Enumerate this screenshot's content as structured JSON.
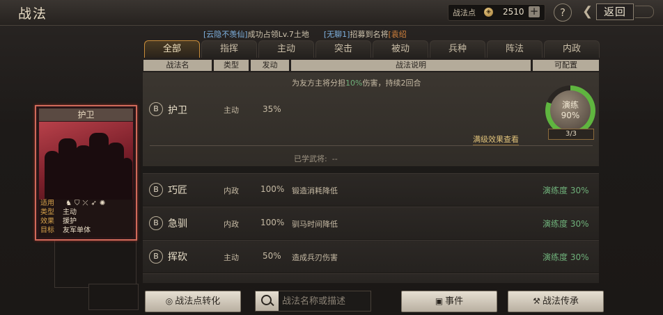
{
  "header": {
    "title": "战法",
    "points_label": "战法点",
    "points_value": "2510",
    "plus": "+",
    "help": "?",
    "back_label": "返回"
  },
  "marquee": {
    "player1": "[云隐不羡仙]",
    "text1": "成功占领Lv.7土地",
    "player2": "[无聊1]",
    "text2": "招募到名将",
    "tail": "[袁绍"
  },
  "tabs": [
    "全部",
    "指挥",
    "主动",
    "突击",
    "被动",
    "兵种",
    "阵法",
    "内政"
  ],
  "columns": {
    "name": "战法名",
    "type": "类型",
    "rate": "发动",
    "desc": "战法说明",
    "config": "可配置"
  },
  "expanded": {
    "grade": "B",
    "name": "护卫",
    "type": "主动",
    "rate": "35%",
    "desc_prefix": "为友方主将分担",
    "desc_pct": "10%",
    "desc_suffix": "伤害，持续2回合",
    "ring_label": "演练",
    "ring_pct": "90%",
    "ring_count": "3/3",
    "max_effect_link": "满级效果查看",
    "learned_label": "已学武将:",
    "learned_value": "--"
  },
  "rows": [
    {
      "grade": "B",
      "name": "巧匠",
      "type": "内政",
      "rate": "100%",
      "desc": "锻造消耗降低",
      "mastery": "演练度 30%"
    },
    {
      "grade": "B",
      "name": "急驯",
      "type": "内政",
      "rate": "100%",
      "desc": "驯马时间降低",
      "mastery": "演练度 30%"
    },
    {
      "grade": "B",
      "name": "挥砍",
      "type": "主动",
      "rate": "50%",
      "desc": "造成兵刃伤害",
      "mastery": "演练度 30%"
    }
  ],
  "card": {
    "title": "护卫",
    "k_suitable": "适用",
    "k_type": "类型",
    "v_type": "主动",
    "k_effect": "效果",
    "v_effect": "援护",
    "k_target": "目标",
    "v_target": "友军单体",
    "unit_icons": [
      "cavalry-icon",
      "shield-icon",
      "bow-icon",
      "spear-icon",
      "siege-icon"
    ]
  },
  "bottom": {
    "convert_label": "战法点转化",
    "search_placeholder": "战法名称或描述",
    "events_label": "事件",
    "inherit_label": "战法传承"
  }
}
